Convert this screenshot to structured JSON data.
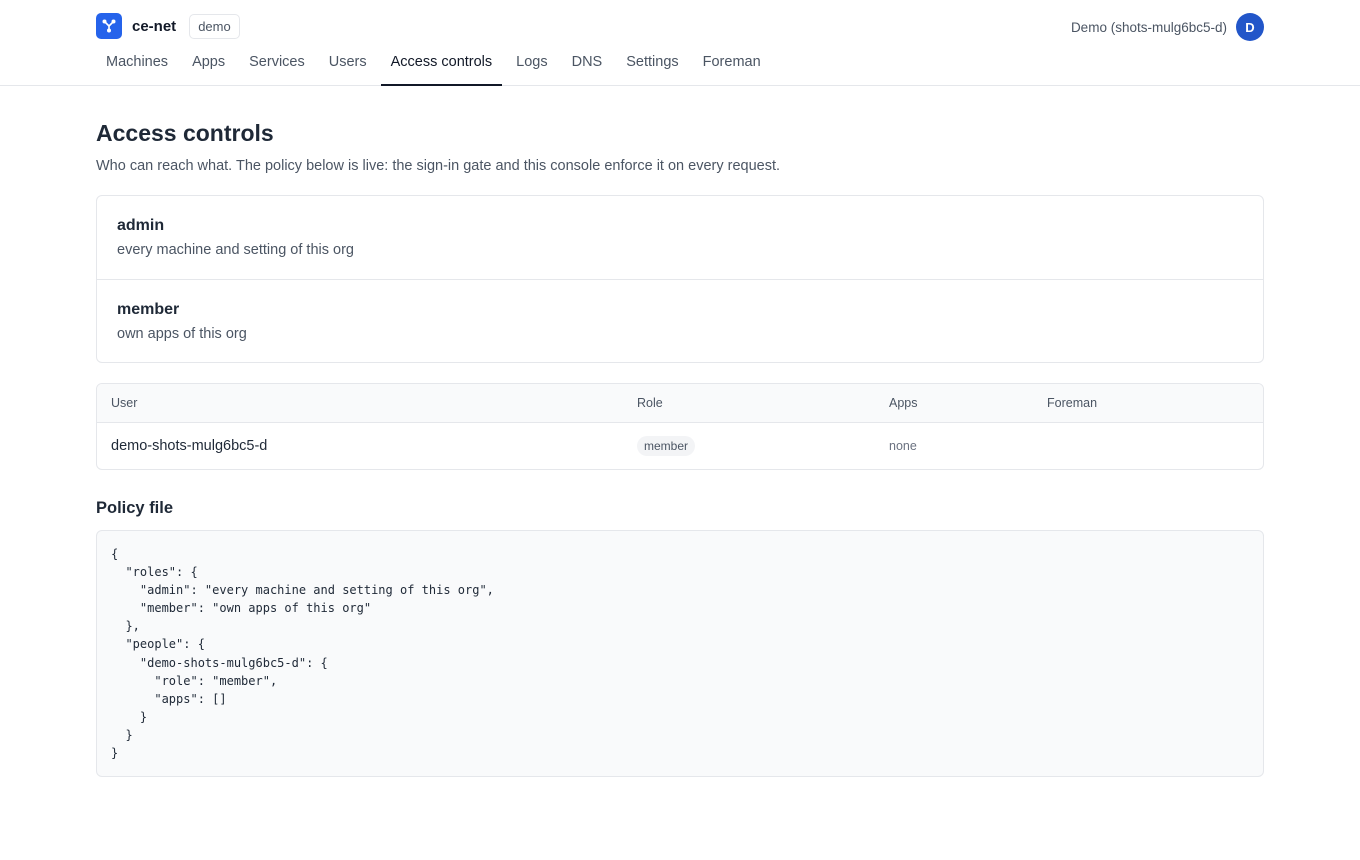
{
  "brand": {
    "name": "ce-net",
    "org_badge": "demo",
    "logo_icon": "network-nodes-icon",
    "accent_color": "#2563eb"
  },
  "account": {
    "label": "Demo (shots-mulg6bc5-d)",
    "avatar_initial": "D",
    "avatar_color": "#2256c9"
  },
  "nav": {
    "tabs": [
      {
        "label": "Machines",
        "active": false
      },
      {
        "label": "Apps",
        "active": false
      },
      {
        "label": "Services",
        "active": false
      },
      {
        "label": "Users",
        "active": false
      },
      {
        "label": "Access controls",
        "active": true
      },
      {
        "label": "Logs",
        "active": false
      },
      {
        "label": "DNS",
        "active": false
      },
      {
        "label": "Settings",
        "active": false
      },
      {
        "label": "Foreman",
        "active": false
      }
    ]
  },
  "page": {
    "title": "Access controls",
    "description": "Who can reach what. The policy below is live: the sign-in gate and this console enforce it on every request."
  },
  "roles": [
    {
      "name": "admin",
      "description": "every machine and setting of this org"
    },
    {
      "name": "member",
      "description": "own apps of this org"
    }
  ],
  "users_table": {
    "headers": {
      "user": "User",
      "role": "Role",
      "apps": "Apps",
      "foreman": "Foreman"
    },
    "rows": [
      {
        "user": "demo-shots-mulg6bc5-d",
        "role": "member",
        "apps": "none",
        "foreman": ""
      }
    ]
  },
  "policy": {
    "heading": "Policy file",
    "content": "{\n  \"roles\": {\n    \"admin\": \"every machine and setting of this org\",\n    \"member\": \"own apps of this org\"\n  },\n  \"people\": {\n    \"demo-shots-mulg6bc5-d\": {\n      \"role\": \"member\",\n      \"apps\": []\n    }\n  }\n}"
  }
}
